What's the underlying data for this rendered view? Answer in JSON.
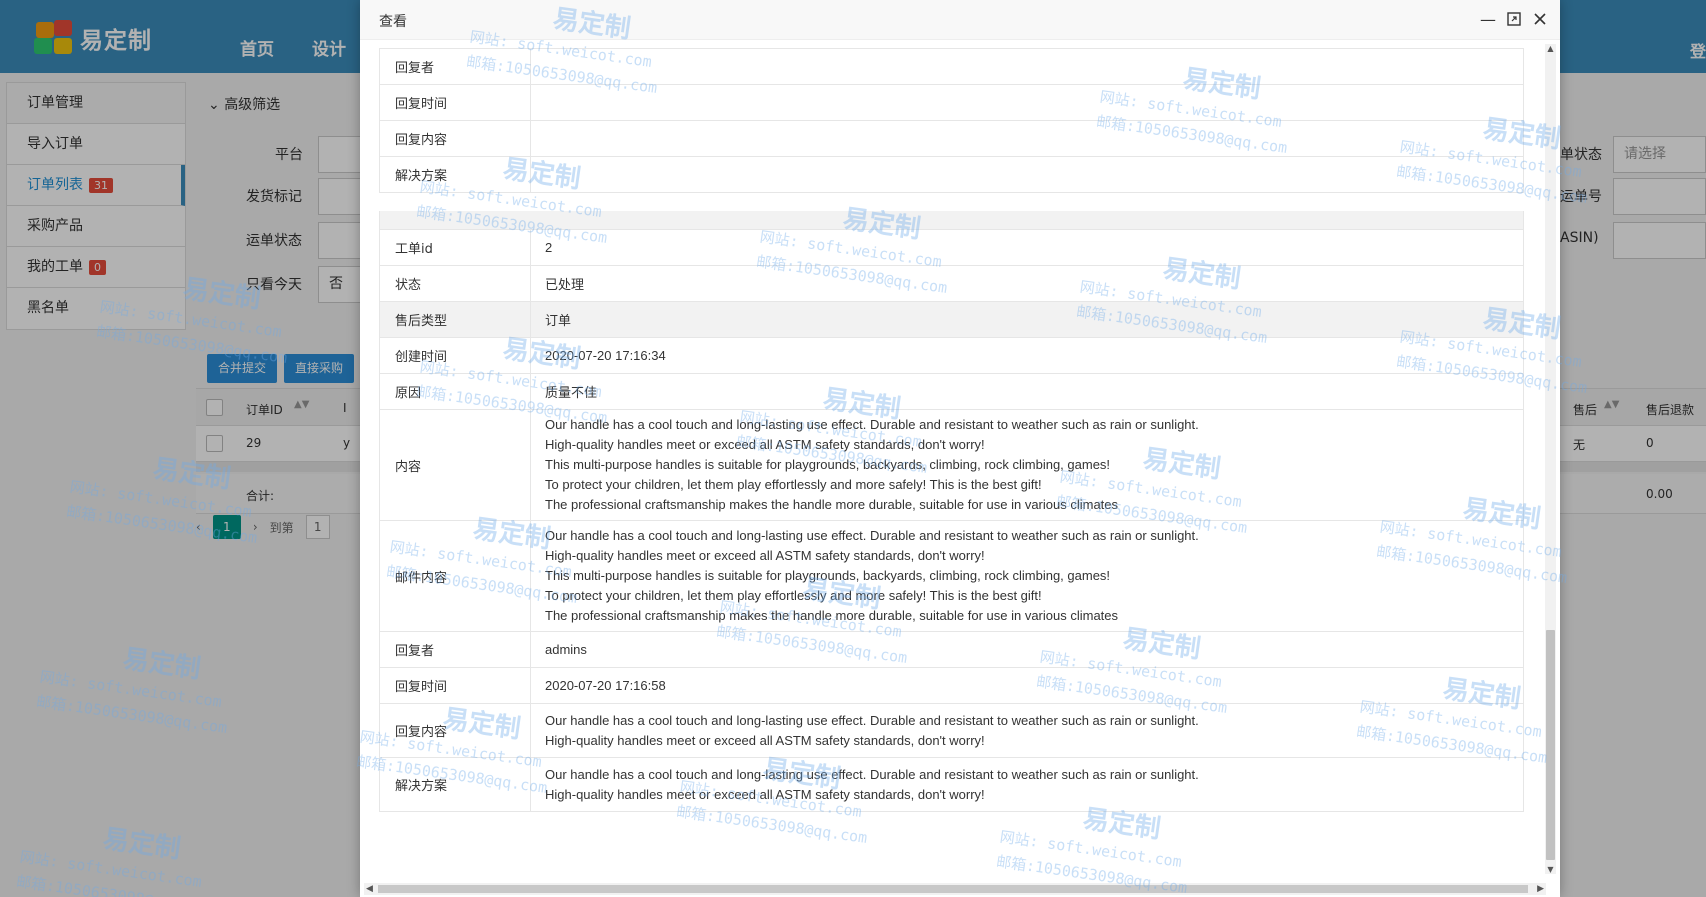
{
  "header": {
    "brand": "易定制",
    "nav": [
      "首页",
      "设计"
    ],
    "login": "登"
  },
  "sidebar": {
    "title": "订单管理",
    "items": [
      {
        "label": "导入订单"
      },
      {
        "label": "订单列表",
        "badge": "31"
      },
      {
        "label": "采购产品"
      },
      {
        "label": "我的工单",
        "badge": "0"
      },
      {
        "label": "黑名单"
      }
    ]
  },
  "filters": {
    "title": "高级筛选",
    "platform_label": "平台",
    "ship_flag_label": "发货标记",
    "waybill_status_label": "运单状态",
    "today_only_label": "只看今天",
    "today_only_value": "否",
    "order_status_label": "单状态",
    "order_status_placeholder": "请选择",
    "waybill_no_label": "运单号",
    "asin_label": "ASIN)"
  },
  "actions": {
    "merge_submit": "合并提交",
    "direct_purchase": "直接采购"
  },
  "grid": {
    "col_order_id": "订单ID",
    "col_col2": "I",
    "col_after_sale": "售后",
    "col_after_refund": "售后退款",
    "row": {
      "order_id": "29",
      "col2": "y",
      "after_sale": "无",
      "after_refund": "0"
    },
    "sum_label": "合计:",
    "sum_value": "0.00"
  },
  "pager": {
    "current": "1",
    "goto_label": "到第",
    "input": "1"
  },
  "modal": {
    "title": "查看",
    "upper_rows": [
      {
        "key": "回复者",
        "value": ""
      },
      {
        "key": "回复时间",
        "value": ""
      },
      {
        "key": "回复内容",
        "value": ""
      },
      {
        "key": "解决方案",
        "value": ""
      }
    ],
    "ticket": {
      "id_label": "工单id",
      "id_value": "2",
      "status_label": "状态",
      "status_value": "已处理",
      "type_label": "售后类型",
      "type_value": "订单",
      "created_label": "创建时间",
      "created_value": "2020-07-20 17:16:34",
      "reason_label": "原因",
      "reason_value": "质量不佳",
      "content_label": "内容",
      "content_lines": [
        "Our handle has a cool touch and long-lasting use effect. Durable and resistant to weather such as rain or sunlight.",
        "High-quality handles meet or exceed all ASTM safety standards, don't worry!",
        "This multi-purpose handles is suitable for playgrounds, backyards, climbing, rock climbing, games!",
        "To protect your children, let them play effortlessly and more safely! This is the best gift!",
        "The professional craftsmanship makes the handle more durable, suitable for use in various climates"
      ],
      "mail_label": "邮件内容",
      "mail_lines": [
        "Our handle has a cool touch and long-lasting use effect. Durable and resistant to weather such as rain or sunlight.",
        "High-quality handles meet or exceed all ASTM safety standards, don't worry!",
        "This multi-purpose handles is suitable for playgrounds, backyards, climbing, rock climbing, games!",
        "To protect your children, let them play effortlessly and more safely! This is the best gift!",
        "The professional craftsmanship makes the handle more durable, suitable for use in various climates"
      ],
      "replier_label": "回复者",
      "replier_value": "admins",
      "reply_time_label": "回复时间",
      "reply_time_value": "2020-07-20 17:16:58",
      "reply_content_label": "回复内容",
      "reply_content_lines": [
        "Our handle has a cool touch and long-lasting use effect. Durable and resistant to weather such as rain or sunlight.",
        "High-quality handles meet or exceed all ASTM safety standards, don't worry!"
      ],
      "solution_label": "解决方案",
      "solution_lines": [
        "Our handle has a cool touch and long-lasting use effect. Durable and resistant to weather such as rain or sunlight.",
        "High-quality handles meet or exceed all ASTM safety standards, don't worry!"
      ]
    }
  },
  "watermark": {
    "brand": "易定制",
    "site": "网站: soft.weicot.com",
    "mail": "邮箱:1050653098@qq.com"
  },
  "colors": {
    "header_bg": "#3c8dbc",
    "primary_button": "#2c8fd8",
    "badge_red": "#e74c3c",
    "pager_active": "#009688"
  }
}
